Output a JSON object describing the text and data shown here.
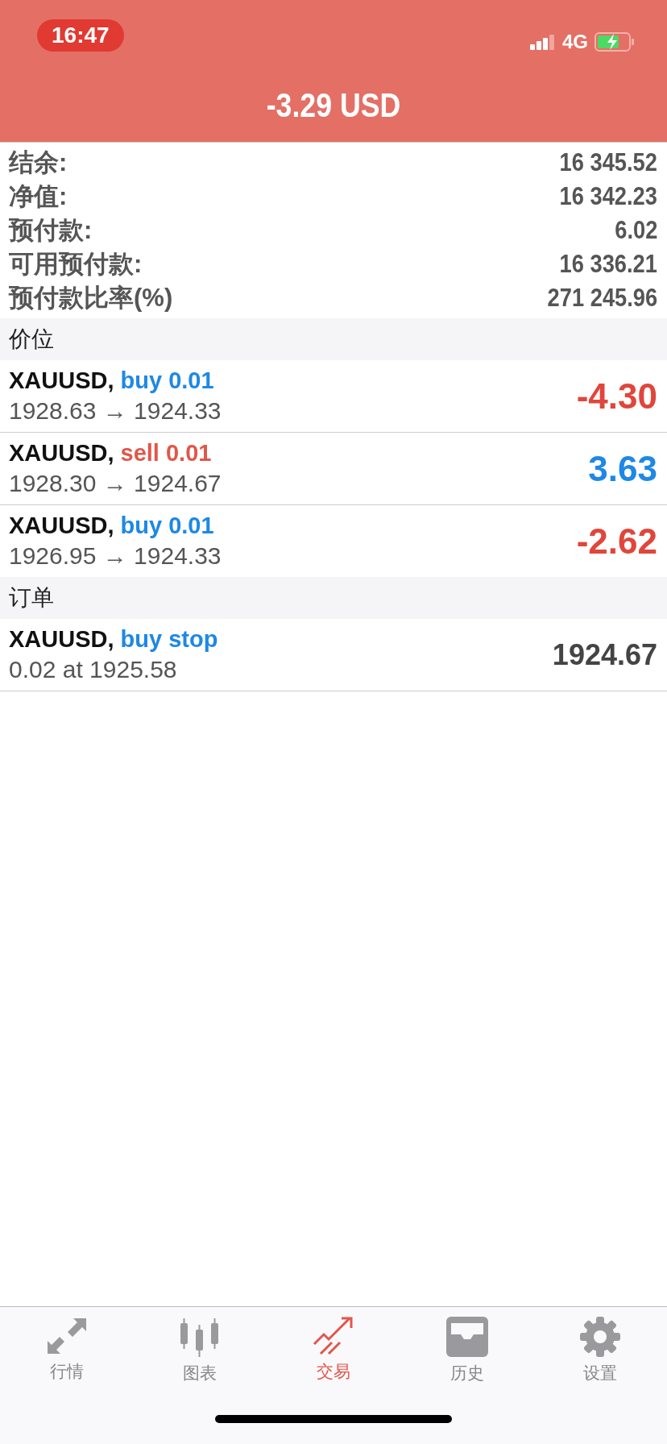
{
  "status_bar": {
    "time": "16:47",
    "network": "4G"
  },
  "header": {
    "title": "-3.29 USD"
  },
  "summary": [
    {
      "label": "结余:",
      "value": "16 345.52"
    },
    {
      "label": "净值:",
      "value": "16 342.23"
    },
    {
      "label": "预付款:",
      "value": "6.02"
    },
    {
      "label": "可用预付款:",
      "value": "16 336.21"
    },
    {
      "label": "预付款比率(%)",
      "value": "271 245.96"
    }
  ],
  "positions": {
    "title": "价位",
    "items": [
      {
        "symbol": "XAUUSD,",
        "action": "buy 0.01",
        "color": "#1e88e5",
        "prices": "1928.63 → 1924.33",
        "profit": {
          "value": "-4.30",
          "color": "#e0463b"
        }
      },
      {
        "symbol": "XAUUSD,",
        "action": "sell 0.01",
        "color": "#e0574b",
        "prices": "1928.30 → 1924.67",
        "profit": {
          "value": "3.63",
          "color": "#1e88e5"
        }
      },
      {
        "symbol": "XAUUSD,",
        "action": "buy 0.01",
        "color": "#1e88e5",
        "prices": "1926.95 → 1924.33",
        "profit": {
          "value": "-2.62",
          "color": "#e0463b"
        }
      }
    ]
  },
  "orders": {
    "title": "订单",
    "items": [
      {
        "symbol": "XAUUSD,",
        "action": "buy stop",
        "color": "#1e88e5",
        "detail": "0.02 at 1925.58",
        "price": "1924.67"
      }
    ]
  },
  "tab_bar": [
    {
      "label": "行情",
      "kind": "quotes",
      "selected": false
    },
    {
      "label": "图表",
      "kind": "chart",
      "selected": false
    },
    {
      "label": "交易",
      "kind": "trade",
      "selected": true
    },
    {
      "label": "历史",
      "kind": "history",
      "selected": false
    },
    {
      "label": "设置",
      "kind": "settings",
      "selected": false
    }
  ]
}
